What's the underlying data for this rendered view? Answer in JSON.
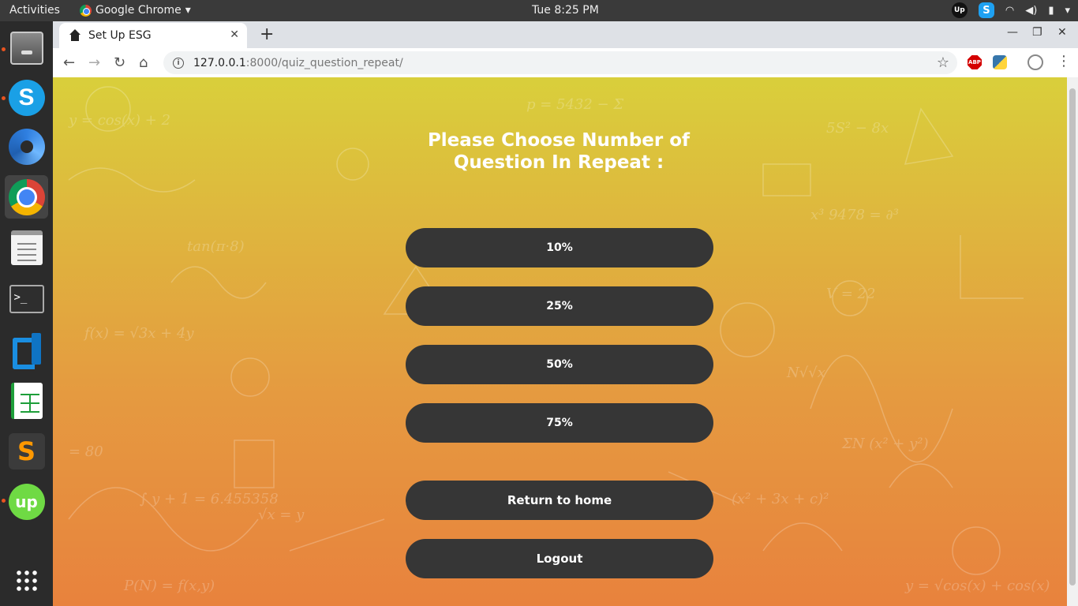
{
  "system": {
    "activities": "Activities",
    "app_name": "Google Chrome",
    "clock": "Tue  8:25 PM",
    "tray_upwork": "Up",
    "tray_skype": "S"
  },
  "dock": {
    "items": [
      "Files",
      "Skype",
      "Krita",
      "Google Chrome",
      "Text Editor",
      "Terminal",
      "Visual Studio Code",
      "LibreOffice Calc",
      "Sublime Text",
      "Upwork",
      "Show Applications"
    ]
  },
  "browser": {
    "tab_title": "Set Up ESG",
    "url_host": "127.0.0.1",
    "url_rest": ":8000/quiz_question_repeat/",
    "ext_abp": "ABP"
  },
  "page": {
    "heading_line1": "Please Choose Number of",
    "heading_line2": "Question In Repeat :",
    "options": [
      "10%",
      "25%",
      "50%",
      "75%"
    ],
    "return_home": "Return to home",
    "logout": "Logout"
  },
  "colors": {
    "gradient_top": "#d9cf3b",
    "gradient_bottom": "#e8823d",
    "button_bg": "#363636",
    "button_text": "#ffffff",
    "heading_text": "#ffffff"
  }
}
